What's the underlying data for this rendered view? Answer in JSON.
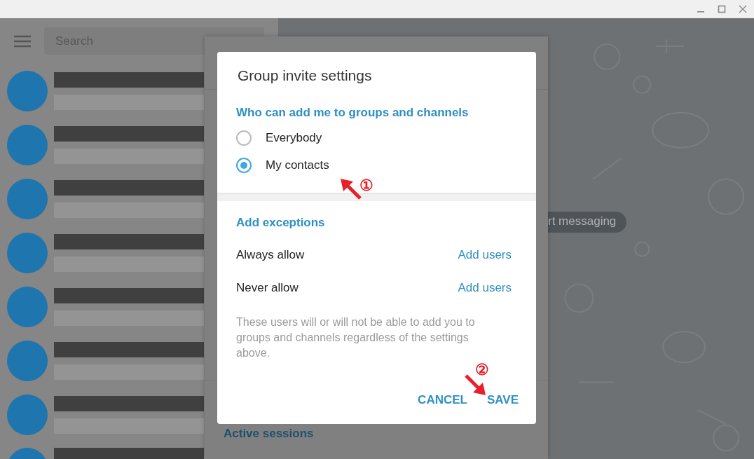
{
  "sidebar": {
    "search": {
      "placeholder": "Search"
    },
    "chats": [
      {
        "kind": "redacted"
      },
      {
        "kind": "redacted"
      },
      {
        "kind": "redacted"
      },
      {
        "kind": "redacted"
      },
      {
        "kind": "redacted"
      },
      {
        "kind": "redacted"
      },
      {
        "kind": "redacted"
      },
      {
        "kind": "partial"
      }
    ]
  },
  "chat_area": {
    "hint": "rt messaging"
  },
  "settings_panel": {
    "item": "Active sessions"
  },
  "dialog": {
    "title": "Group invite settings",
    "section": "Who can add me to groups and channels",
    "options": [
      {
        "label": "Everybody",
        "selected": false
      },
      {
        "label": "My contacts",
        "selected": true
      }
    ],
    "exceptions_header": "Add exceptions",
    "exceptions": [
      {
        "label": "Always allow",
        "action": "Add users"
      },
      {
        "label": "Never allow",
        "action": "Add users"
      }
    ],
    "note": "These users will or will not be able to add you to groups and channels regardless of the settings above.",
    "buttons": [
      {
        "label": "CANCEL"
      },
      {
        "label": "SAVE"
      }
    ]
  },
  "annotations": [
    {
      "number": "①"
    },
    {
      "number": "②"
    }
  ]
}
